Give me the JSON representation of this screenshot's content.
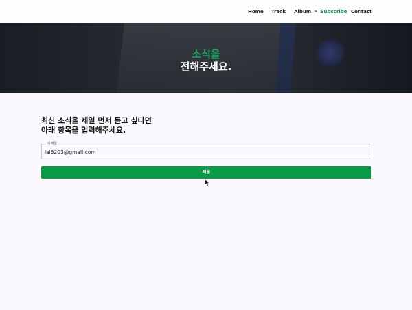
{
  "nav": {
    "items": [
      {
        "label": "Home"
      },
      {
        "label": "Track"
      },
      {
        "label": "Album"
      },
      {
        "label": "Subscribe",
        "bullet": "•",
        "active": true
      },
      {
        "label": "Contact"
      }
    ]
  },
  "hero": {
    "line1": "소식을",
    "line2": "전해주세요."
  },
  "form": {
    "intro_line1": "최신 소식을 제일 먼저 듣고 싶다면",
    "intro_line2": "아래 항목을 입력해주세요.",
    "email_label": "이메일",
    "email_value": "ial6203@gmail.com",
    "submit_label": "제출"
  },
  "colors": {
    "accent": "#0a9b49",
    "hero_accent_text": "#19a35a",
    "hero_bg": "#1f232a",
    "page_bg": "#fbf9fd"
  }
}
